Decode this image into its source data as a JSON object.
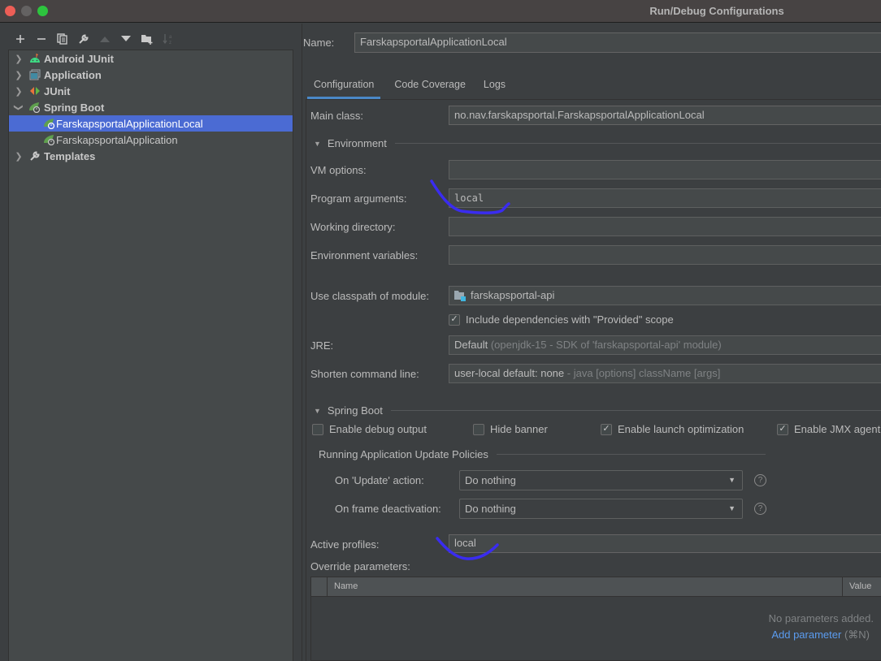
{
  "window": {
    "title": "Run/Debug Configurations"
  },
  "toolbar": {
    "buttons": [
      {
        "name": "add-configuration-button",
        "icon": "plus-icon",
        "glyph": "+",
        "enabled": true
      },
      {
        "name": "remove-configuration-button",
        "icon": "minus-icon",
        "glyph": "−",
        "enabled": true
      },
      {
        "name": "copy-configuration-button",
        "icon": "copy-icon",
        "glyph": "❐",
        "enabled": true
      },
      {
        "name": "edit-defaults-button",
        "icon": "wrench-icon",
        "glyph": "🔧",
        "enabled": true
      },
      {
        "name": "move-up-button",
        "icon": "arrow-up-icon",
        "glyph": "▲",
        "enabled": false
      },
      {
        "name": "move-down-button",
        "icon": "arrow-down-icon",
        "glyph": "▼",
        "enabled": true
      },
      {
        "name": "new-folder-button",
        "icon": "folder-add-icon",
        "glyph": "▆",
        "enabled": true
      },
      {
        "name": "sort-button",
        "icon": "sort-alpha-icon",
        "glyph": "↓ᵃ",
        "enabled": false
      }
    ]
  },
  "tree": {
    "items": [
      {
        "label": "Android JUnit",
        "icon": "android-icon",
        "expanded": false,
        "level": 0
      },
      {
        "label": "Application",
        "icon": "application-window-icon",
        "expanded": false,
        "level": 0
      },
      {
        "label": "JUnit",
        "icon": "junit-icon",
        "expanded": false,
        "level": 0
      },
      {
        "label": "Spring Boot",
        "icon": "spring-boot-icon",
        "expanded": true,
        "level": 0
      },
      {
        "label": "FarskapsportalApplicationLocal",
        "icon": "spring-boot-icon",
        "level": 1,
        "selected": true
      },
      {
        "label": "FarskapsportalApplication",
        "icon": "spring-boot-icon",
        "level": 1
      },
      {
        "label": "Templates",
        "icon": "wrench-icon",
        "expanded": false,
        "level": 0
      }
    ]
  },
  "form": {
    "name_label": "Name:",
    "name_value": "FarskapsportalApplicationLocal",
    "tabs": [
      "Configuration",
      "Code Coverage",
      "Logs"
    ],
    "active_tab": "Configuration",
    "main_class_label": "Main class:",
    "main_class_value": "no.nav.farskapsportal.FarskapsportalApplicationLocal",
    "environment": {
      "title": "Environment",
      "vm_options_label": "VM options:",
      "vm_options_value": "",
      "program_args_label": "Program arguments:",
      "program_args_value": "local",
      "working_dir_label": "Working directory:",
      "working_dir_value": "",
      "env_vars_label": "Environment variables:",
      "env_vars_value": ""
    },
    "classpath_label": "Use classpath of module:",
    "classpath_value": "farskapsportal-api",
    "include_provided_label": "Include dependencies with \"Provided\" scope",
    "include_provided_checked": true,
    "jre_label": "JRE:",
    "jre_value": "Default",
    "jre_hint": "(openjdk-15 - SDK of 'farskapsportal-api' module)",
    "shorten_label": "Shorten command line:",
    "shorten_value": "user-local default: none",
    "shorten_hint": "- java [options] className [args]",
    "spring_boot": {
      "title": "Spring Boot",
      "checkboxes": [
        {
          "label": "Enable debug output",
          "checked": false
        },
        {
          "label": "Hide banner",
          "checked": false
        },
        {
          "label": "Enable launch optimization",
          "checked": true
        },
        {
          "label": "Enable JMX agent",
          "checked": true
        }
      ],
      "policies_title": "Running Application Update Policies",
      "update_action_label": "On 'Update' action:",
      "update_action_value": "Do nothing",
      "frame_deactivation_label": "On frame deactivation:",
      "frame_deactivation_value": "Do nothing",
      "help_glyph": "?"
    },
    "active_profiles_label": "Active profiles:",
    "active_profiles_value": "local",
    "override_label": "Override parameters:",
    "override_table": {
      "columns": [
        "Name",
        "Value"
      ],
      "rows": [],
      "empty_text": "No parameters added.",
      "add_link": "Add parameter",
      "add_shortcut": "(⌘N)"
    }
  },
  "colors": {
    "selection": "#4b6bd3",
    "tab_underline": "#4a88c7",
    "link": "#5b9cf0",
    "annotation": "#3a2cf0"
  }
}
